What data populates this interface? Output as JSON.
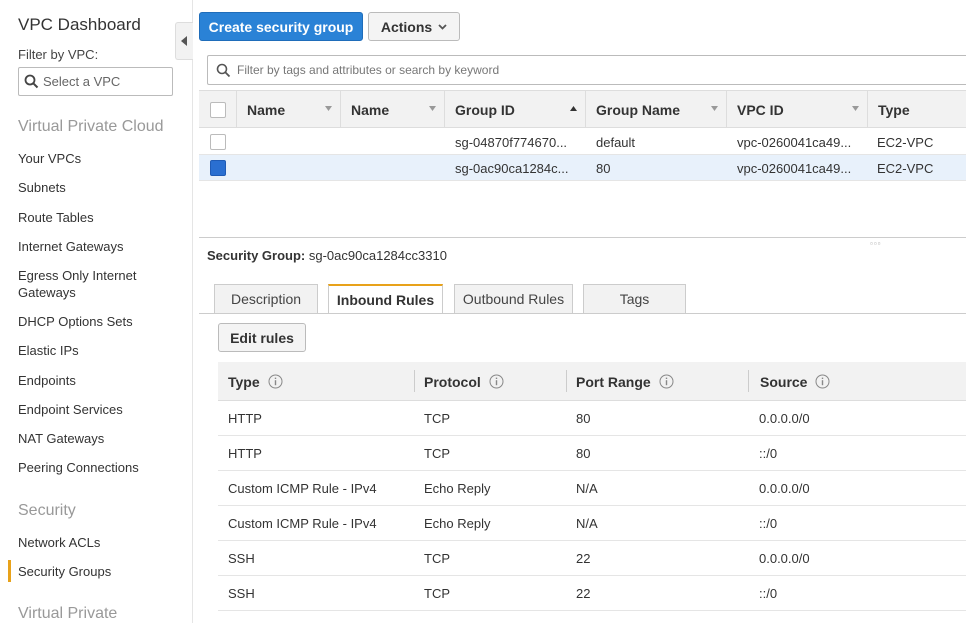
{
  "sidebar": {
    "title": "VPC Dashboard",
    "filter_label": "Filter by VPC:",
    "vpc_placeholder": "Select a VPC",
    "section_vpc": "Virtual Private Cloud",
    "vpc_items": [
      "Your VPCs",
      "Subnets",
      "Route Tables",
      "Internet Gateways",
      "Egress Only Internet Gateways",
      "DHCP Options Sets",
      "Elastic IPs",
      "Endpoints",
      "Endpoint Services",
      "NAT Gateways",
      "Peering Connections"
    ],
    "section_security": "Security",
    "security_items": [
      "Network ACLs",
      "Security Groups"
    ],
    "section_vpn": "Virtual Private",
    "active_item": "Security Groups"
  },
  "toolbar": {
    "create_label": "Create security group",
    "actions_label": "Actions"
  },
  "search": {
    "placeholder": "Filter by tags and attributes or search by keyword"
  },
  "grid": {
    "columns": [
      "Name",
      "Name",
      "Group ID",
      "Group Name",
      "VPC ID",
      "Type"
    ],
    "rows": [
      {
        "name1": "",
        "name2": "",
        "group_id": "sg-04870f774670...",
        "group_name": "default",
        "vpc_id": "vpc-0260041ca49...",
        "type": "EC2-VPC",
        "selected": false
      },
      {
        "name1": "",
        "name2": "",
        "group_id": "sg-0ac90ca1284c...",
        "group_name": "80",
        "vpc_id": "vpc-0260041ca49...",
        "type": "EC2-VPC",
        "selected": true
      }
    ]
  },
  "detail": {
    "label": "Security Group:",
    "sg_id": "sg-0ac90ca1284cc3310",
    "tabs": [
      "Description",
      "Inbound Rules",
      "Outbound Rules",
      "Tags"
    ],
    "active_tab": "Inbound Rules",
    "edit_label": "Edit rules",
    "rule_columns": [
      "Type",
      "Protocol",
      "Port Range",
      "Source"
    ],
    "rules": [
      {
        "type": "HTTP",
        "protocol": "TCP",
        "port": "80",
        "source": "0.0.0.0/0"
      },
      {
        "type": "HTTP",
        "protocol": "TCP",
        "port": "80",
        "source": "::/0"
      },
      {
        "type": "Custom ICMP Rule - IPv4",
        "protocol": "Echo Reply",
        "port": "N/A",
        "source": "0.0.0.0/0"
      },
      {
        "type": "Custom ICMP Rule - IPv4",
        "protocol": "Echo Reply",
        "port": "N/A",
        "source": "::/0"
      },
      {
        "type": "SSH",
        "protocol": "TCP",
        "port": "22",
        "source": "0.0.0.0/0"
      },
      {
        "type": "SSH",
        "protocol": "TCP",
        "port": "22",
        "source": "::/0"
      }
    ]
  },
  "colors": {
    "primary": "#2a82d6",
    "active_accent": "#e8a21a",
    "selected_row": "#e8f1fb"
  }
}
